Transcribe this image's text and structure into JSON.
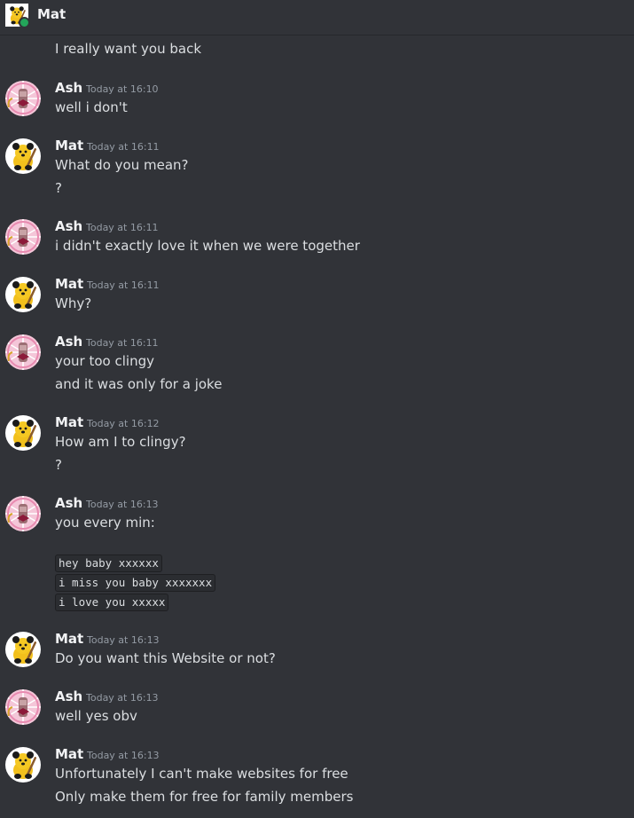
{
  "header": {
    "name": "Mat",
    "avatar_icon": "sooty-bear-avatar",
    "status": "online"
  },
  "colors": {
    "background": "#313338",
    "online": "#23a55a",
    "ash_avatar_bg": "#f4c6d8",
    "mat_avatar_bg": "#ffffff"
  },
  "messages": [
    {
      "continuation_text": "I really want you back"
    },
    {
      "author": "Ash",
      "time": "Today at 16:10",
      "lines": [
        "well i don't"
      ]
    },
    {
      "author": "Mat",
      "time": "Today at 16:11",
      "lines": [
        "What do you mean?",
        "?"
      ]
    },
    {
      "author": "Ash",
      "time": "Today at 16:11",
      "lines": [
        "i didn't exactly love it when we were together"
      ]
    },
    {
      "author": "Mat",
      "time": "Today at 16:11",
      "lines": [
        "Why?"
      ]
    },
    {
      "author": "Ash",
      "time": "Today at 16:11",
      "lines": [
        "your too clingy",
        "and it was only for a joke"
      ]
    },
    {
      "author": "Mat",
      "time": "Today at 16:12",
      "lines": [
        "How am I to clingy?",
        "?"
      ]
    },
    {
      "author": "Ash",
      "time": "Today at 16:13",
      "lines": [
        "you every min:"
      ],
      "code_lines": [
        "hey baby xxxxxx",
        "i miss you baby xxxxxxx",
        "i love you xxxxx"
      ]
    },
    {
      "author": "Mat",
      "time": "Today at 16:13",
      "lines": [
        "Do you want this Website or not?"
      ]
    },
    {
      "author": "Ash",
      "time": "Today at 16:13",
      "lines": [
        "well yes obv"
      ]
    },
    {
      "author": "Mat",
      "time": "Today at 16:13",
      "lines": [
        "Unfortunately I can't make websites for free",
        "Only make them for free for family members"
      ]
    }
  ]
}
